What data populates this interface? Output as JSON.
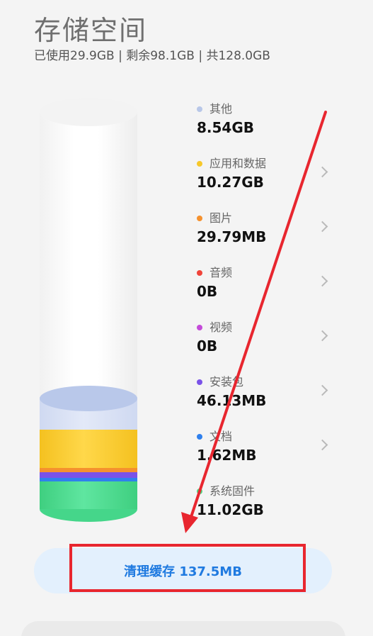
{
  "header": {
    "title": "存储空间",
    "summary": "已使用29.9GB | 剩余98.1GB | 共128.0GB"
  },
  "categories": [
    {
      "label": "其他",
      "value": "8.54GB",
      "color": "#b8c7e8",
      "has_chevron": false
    },
    {
      "label": "应用和数据",
      "value": "10.27GB",
      "color": "#f7c82a",
      "has_chevron": true
    },
    {
      "label": "图片",
      "value": "29.79MB",
      "color": "#f5912e",
      "has_chevron": true
    },
    {
      "label": "音频",
      "value": "0B",
      "color": "#f0443a",
      "has_chevron": true
    },
    {
      "label": "视频",
      "value": "0B",
      "color": "#c44bd9",
      "has_chevron": true
    },
    {
      "label": "安装包",
      "value": "46.13MB",
      "color": "#7a52e8",
      "has_chevron": true
    },
    {
      "label": "文档",
      "value": "1.62MB",
      "color": "#2f80ed",
      "has_chevron": true
    },
    {
      "label": "系统固件",
      "value": "11.02GB",
      "color": "#4fd884",
      "has_chevron": false
    }
  ],
  "actions": {
    "clear_cache_label": "清理缓存 137.5MB"
  },
  "annotation": {
    "highlight_color": "#e8262f"
  }
}
